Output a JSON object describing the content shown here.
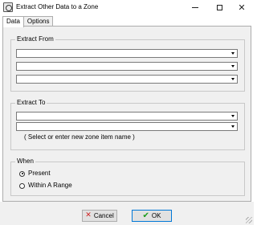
{
  "window": {
    "title": "Extract Other Data to a Zone",
    "controls": {
      "minimize": "minimize-icon",
      "maximize": "maximize-icon",
      "close": "close-icon",
      "close_glyph": "✕"
    }
  },
  "tabs": [
    {
      "label": "Data",
      "active": true
    },
    {
      "label": "Options",
      "active": false
    }
  ],
  "extract_from": {
    "label": "Extract From",
    "combos": [
      {
        "value": ""
      },
      {
        "value": ""
      },
      {
        "value": ""
      }
    ]
  },
  "extract_to": {
    "label": "Extract To",
    "combos": [
      {
        "value": ""
      },
      {
        "value": ""
      }
    ],
    "hint": "( Select or enter new zone item name )"
  },
  "when": {
    "label": "When",
    "options": [
      {
        "label": "Present",
        "selected": true
      },
      {
        "label": "Within A Range",
        "selected": false
      }
    ]
  },
  "footer": {
    "cancel_label": "Cancel",
    "cancel_glyph": "✕",
    "ok_label": "OK",
    "ok_glyph": "✔"
  },
  "colors": {
    "panel": "#f0f0f0",
    "accent_border": "#0078d7",
    "cancel_icon": "#d02020",
    "ok_icon": "#1a9a1a"
  }
}
